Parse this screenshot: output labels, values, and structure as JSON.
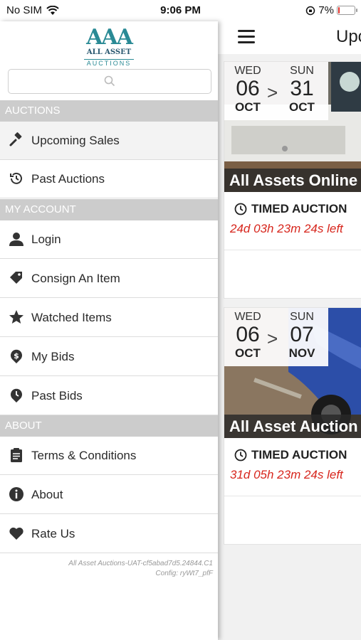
{
  "status_bar": {
    "carrier": "No SIM",
    "time": "9:06 PM",
    "battery": "7%",
    "battery_level": 0.07
  },
  "main": {
    "title": "Upc",
    "auctions": [
      {
        "from": {
          "dow": "WED",
          "day": "06",
          "month": "OCT"
        },
        "to": {
          "dow": "SUN",
          "day": "31",
          "month": "OCT"
        },
        "separator": ">",
        "name": "All Assets Online",
        "type": "TIMED AUCTION",
        "time_left": "24d 03h 23m 24s left"
      },
      {
        "from": {
          "dow": "WED",
          "day": "06",
          "month": "OCT"
        },
        "to": {
          "dow": "SUN",
          "day": "07",
          "month": "NOV"
        },
        "separator": ">",
        "name": "All Asset Auction",
        "type": "TIMED AUCTION",
        "time_left": "31d 05h 23m 24s left"
      }
    ]
  },
  "drawer": {
    "logo": {
      "mark": "AAA",
      "name": "ALL ASSET",
      "sub": "AUCTIONS"
    },
    "search": {
      "placeholder": ""
    },
    "sections": {
      "auctions": "AUCTIONS",
      "my_account": "MY ACCOUNT",
      "about": "ABOUT"
    },
    "items": {
      "upcoming_sales": "Upcoming Sales",
      "past_auctions": "Past Auctions",
      "login": "Login",
      "consign": "Consign An Item",
      "watched": "Watched Items",
      "my_bids": "My Bids",
      "past_bids": "Past Bids",
      "terms": "Terms & Conditions",
      "about": "About",
      "rate_us": "Rate Us"
    },
    "footer": {
      "line1": "All Asset Auctions-UAT-cf5abad7d5.24844.C1",
      "line2": "Config: ryWt7_pfF"
    }
  },
  "colors": {
    "accent_teal": "#2a8a95",
    "time_left_red": "#d7261d",
    "section_grey": "#cccccc"
  }
}
